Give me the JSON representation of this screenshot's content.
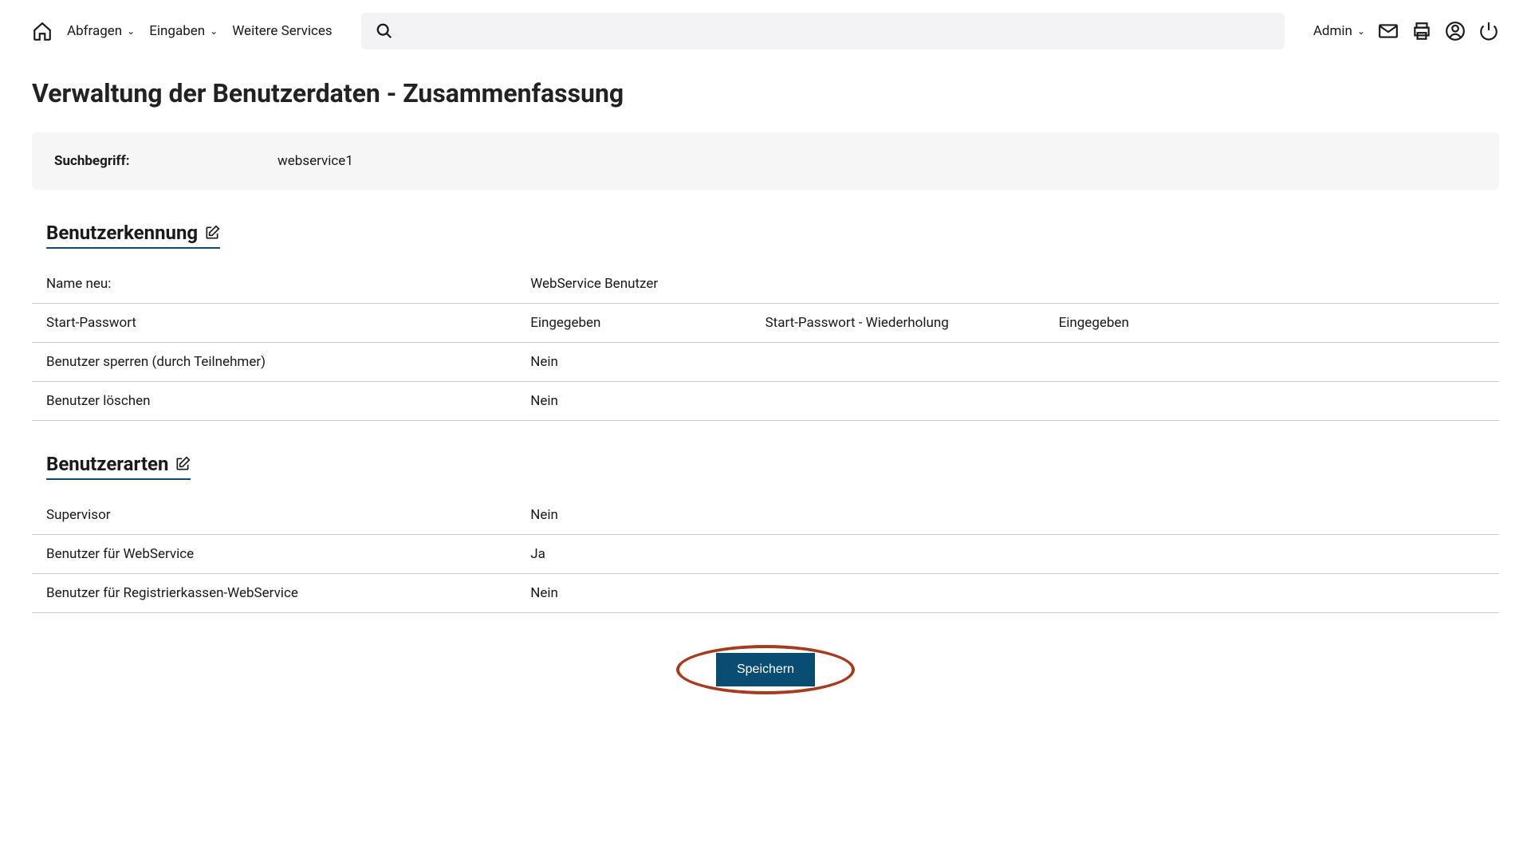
{
  "nav": {
    "abfragen": "Abfragen",
    "eingaben": "Eingaben",
    "weitere": "Weitere Services",
    "admin": "Admin"
  },
  "page_title": "Verwaltung der Benutzerdaten - Zusammenfassung",
  "search": {
    "label": "Suchbegriff:",
    "value": "webservice1"
  },
  "section1": {
    "heading": "Benutzerkennung",
    "rows": [
      {
        "label": "Name neu:",
        "value": "WebService Benutzer",
        "label2": "",
        "value2": ""
      },
      {
        "label": "Start-Passwort",
        "value": "Eingegeben",
        "label2": "Start-Passwort - Wiederholung",
        "value2": "Eingegeben"
      },
      {
        "label": "Benutzer sperren (durch Teilnehmer)",
        "value": "Nein",
        "label2": "",
        "value2": ""
      },
      {
        "label": "Benutzer löschen",
        "value": "Nein",
        "label2": "",
        "value2": ""
      }
    ]
  },
  "section2": {
    "heading": "Benutzerarten",
    "rows": [
      {
        "label": "Supervisor",
        "value": "Nein"
      },
      {
        "label": "Benutzer für WebService",
        "value": "Ja"
      },
      {
        "label": "Benutzer für Registrierkassen-WebService",
        "value": "Nein"
      }
    ]
  },
  "save_button": "Speichern"
}
